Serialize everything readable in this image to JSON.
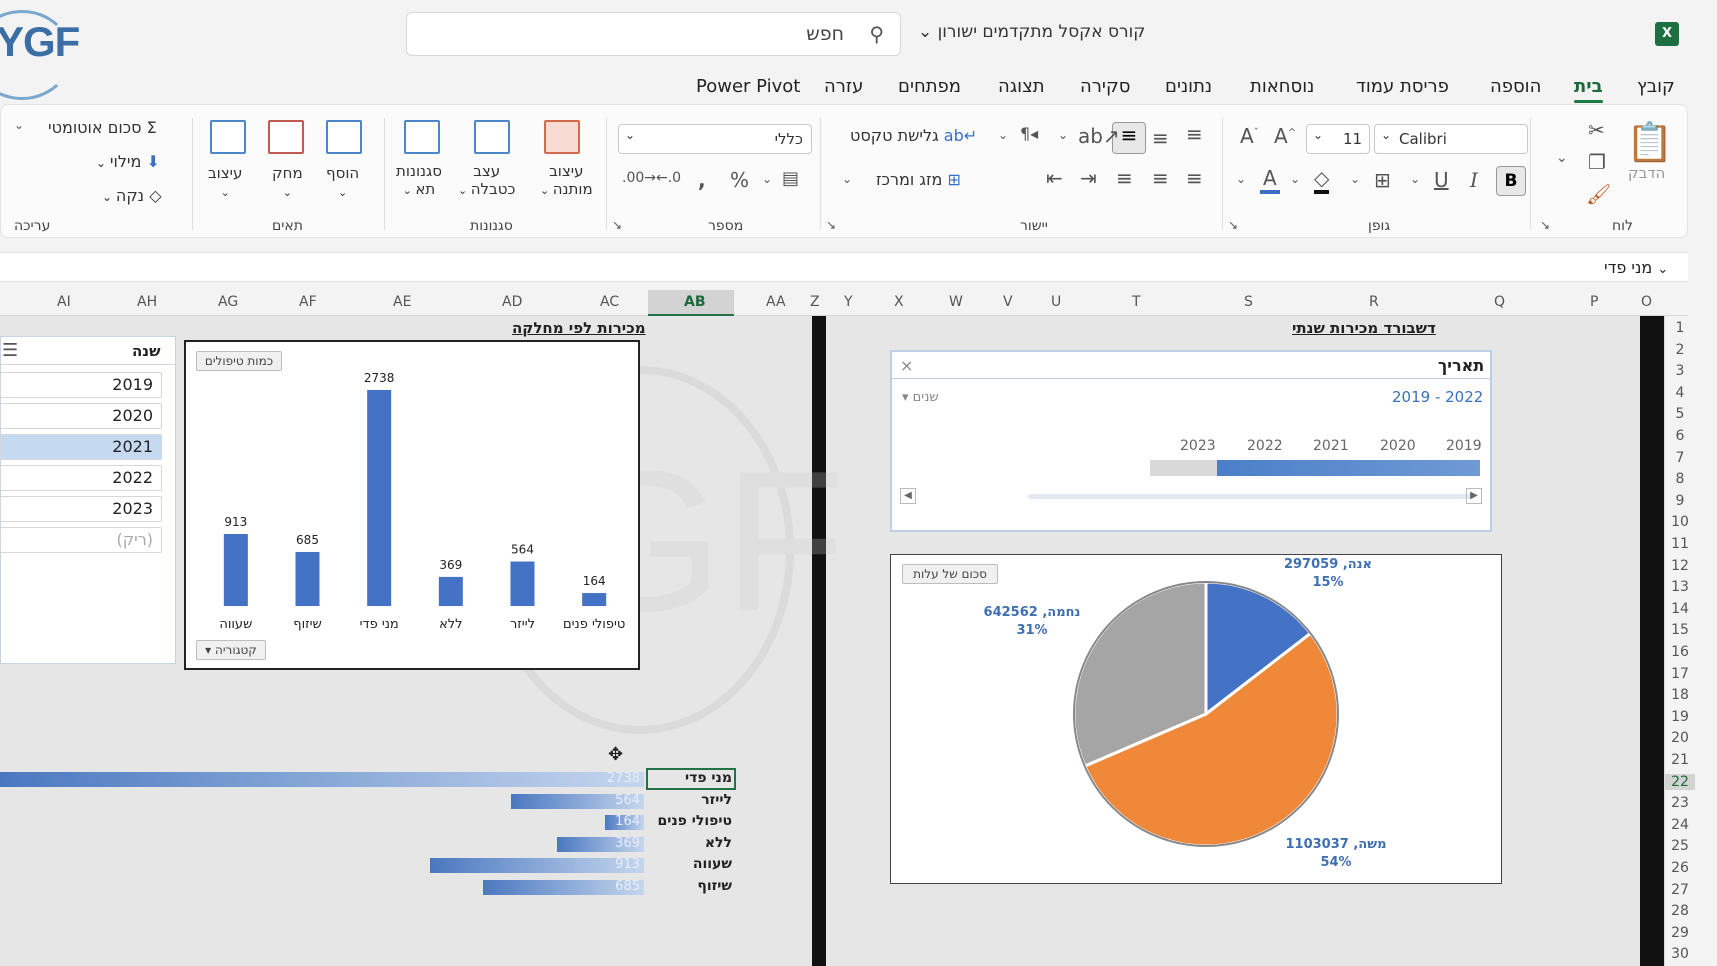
{
  "window": {
    "doc_title": "קורס אקסל מתקדמים ישורון",
    "search_placeholder": "חפש",
    "logo_text": "YGF",
    "app_icon": "X"
  },
  "tabs": [
    "קובץ",
    "בית",
    "הוספה",
    "פריסת עמוד",
    "נוסחאות",
    "נתונים",
    "סקירה",
    "תצוגה",
    "מפתחים",
    "עזרה",
    "Power Pivot"
  ],
  "ribbon": {
    "groups": {
      "clipboard": "לוח",
      "font": "גופן",
      "alignment": "יישור",
      "number": "מספר",
      "styles": "סגנונות",
      "cells": "תאים",
      "editing": "עריכה"
    },
    "paste": "הדבק",
    "font_name": "Calibri",
    "font_size": "11",
    "wrap_text": "גלישת טקסט",
    "merge_center": "מזג ומרכז",
    "number_format": "כללי",
    "conditional_format": [
      "עיצוב",
      "מותנה"
    ],
    "format_table": [
      "עצב",
      "כטבלה"
    ],
    "cell_styles": [
      "סגנונות",
      "תא"
    ],
    "insert": "הוסף",
    "delete": "מחק",
    "format": "עיצוב",
    "autosum": "סכום אוטומטי",
    "fill": "מילוי",
    "clear": "נקה",
    "bold": "B",
    "italic": "I",
    "underline": "U"
  },
  "name_box": "מני פדי",
  "columns": [
    "AI",
    "AH",
    "AG",
    "AF",
    "AE",
    "AD",
    "AC",
    "AB",
    "AA",
    "Z",
    "Y",
    "X",
    "W",
    "V",
    "U",
    "T",
    "S",
    "R",
    "Q",
    "P",
    "O"
  ],
  "rows": [
    "1",
    "2",
    "3",
    "4",
    "5",
    "6",
    "7",
    "8",
    "9",
    "10",
    "11",
    "12",
    "13",
    "14",
    "15",
    "16",
    "17",
    "18",
    "19",
    "20",
    "21",
    "22",
    "23",
    "24",
    "25",
    "26",
    "27",
    "28",
    "29",
    "30"
  ],
  "year_slicer": {
    "title": "שנה",
    "items": [
      "2019",
      "2020",
      "2021",
      "2022",
      "2023",
      "(ריק)"
    ],
    "selected": "2021"
  },
  "dept_chart": {
    "heading": "מכירות לפי מחלקה",
    "value_pill": "כמות טיפולים",
    "axis_pill": "קטגוריה"
  },
  "chart_data": {
    "type": "bar",
    "categories": [
      "שעווה",
      "שיזוף",
      "מני פדי",
      "ללא",
      "לייזר",
      "טיפולי פנים"
    ],
    "values": [
      913,
      685,
      2738,
      369,
      564,
      164
    ],
    "ylim": [
      0,
      2738
    ]
  },
  "annual": {
    "heading": "דשבורד מכירות שנתי",
    "timeline_title": "תאריך",
    "timeline_range": "2019 - 2022",
    "timeline_unit": "שנים",
    "timeline_years": [
      "2023",
      "2022",
      "2021",
      "2020",
      "2019"
    ]
  },
  "pie": {
    "pill": "סכום של עלות",
    "slices": [
      {
        "label": "אנה, 297059",
        "pct": "15%",
        "value": 297059,
        "color": "#4472c4"
      },
      {
        "label": "משה, 1103037",
        "pct": "54%",
        "value": 1103037,
        "color": "#f0883a"
      },
      {
        "label": "נחמה, 642562",
        "pct": "31%",
        "value": 642562,
        "color": "#a5a5a5"
      }
    ]
  },
  "databars": [
    {
      "label": "מני פדי",
      "value": "2738",
      "frac": 1.0
    },
    {
      "label": "לייזר",
      "value": "564",
      "frac": 0.206
    },
    {
      "label": "טיפולי פנים",
      "value": "164",
      "frac": 0.06
    },
    {
      "label": "ללא",
      "value": "369",
      "frac": 0.135
    },
    {
      "label": "שעווה",
      "value": "913",
      "frac": 0.333
    },
    {
      "label": "שיזוף",
      "value": "685",
      "frac": 0.25
    }
  ]
}
